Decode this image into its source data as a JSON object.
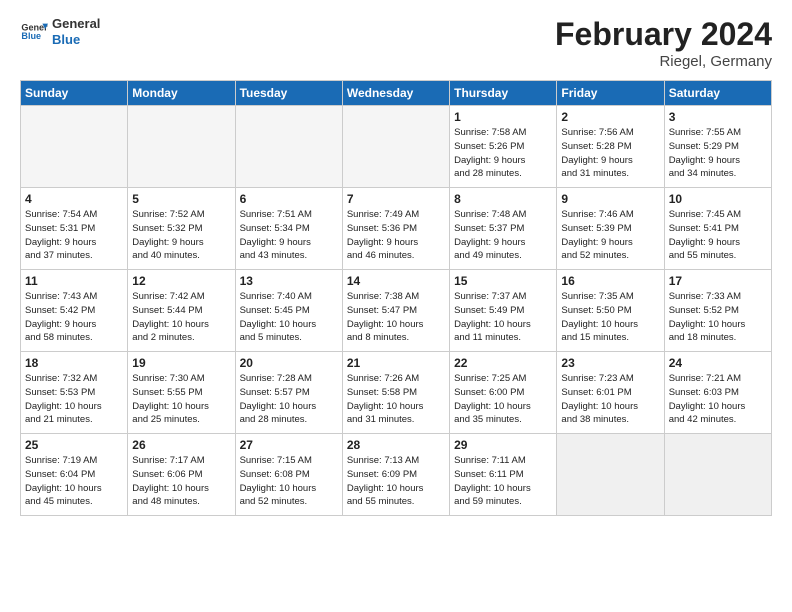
{
  "logo": {
    "general": "General",
    "blue": "Blue"
  },
  "title": "February 2024",
  "subtitle": "Riegel, Germany",
  "days_of_week": [
    "Sunday",
    "Monday",
    "Tuesday",
    "Wednesday",
    "Thursday",
    "Friday",
    "Saturday"
  ],
  "weeks": [
    [
      {
        "num": "",
        "info": "",
        "empty": true
      },
      {
        "num": "",
        "info": "",
        "empty": true
      },
      {
        "num": "",
        "info": "",
        "empty": true
      },
      {
        "num": "",
        "info": "",
        "empty": true
      },
      {
        "num": "1",
        "info": "Sunrise: 7:58 AM\nSunset: 5:26 PM\nDaylight: 9 hours\nand 28 minutes."
      },
      {
        "num": "2",
        "info": "Sunrise: 7:56 AM\nSunset: 5:28 PM\nDaylight: 9 hours\nand 31 minutes."
      },
      {
        "num": "3",
        "info": "Sunrise: 7:55 AM\nSunset: 5:29 PM\nDaylight: 9 hours\nand 34 minutes."
      }
    ],
    [
      {
        "num": "4",
        "info": "Sunrise: 7:54 AM\nSunset: 5:31 PM\nDaylight: 9 hours\nand 37 minutes."
      },
      {
        "num": "5",
        "info": "Sunrise: 7:52 AM\nSunset: 5:32 PM\nDaylight: 9 hours\nand 40 minutes."
      },
      {
        "num": "6",
        "info": "Sunrise: 7:51 AM\nSunset: 5:34 PM\nDaylight: 9 hours\nand 43 minutes."
      },
      {
        "num": "7",
        "info": "Sunrise: 7:49 AM\nSunset: 5:36 PM\nDaylight: 9 hours\nand 46 minutes."
      },
      {
        "num": "8",
        "info": "Sunrise: 7:48 AM\nSunset: 5:37 PM\nDaylight: 9 hours\nand 49 minutes."
      },
      {
        "num": "9",
        "info": "Sunrise: 7:46 AM\nSunset: 5:39 PM\nDaylight: 9 hours\nand 52 minutes."
      },
      {
        "num": "10",
        "info": "Sunrise: 7:45 AM\nSunset: 5:41 PM\nDaylight: 9 hours\nand 55 minutes."
      }
    ],
    [
      {
        "num": "11",
        "info": "Sunrise: 7:43 AM\nSunset: 5:42 PM\nDaylight: 9 hours\nand 58 minutes."
      },
      {
        "num": "12",
        "info": "Sunrise: 7:42 AM\nSunset: 5:44 PM\nDaylight: 10 hours\nand 2 minutes."
      },
      {
        "num": "13",
        "info": "Sunrise: 7:40 AM\nSunset: 5:45 PM\nDaylight: 10 hours\nand 5 minutes."
      },
      {
        "num": "14",
        "info": "Sunrise: 7:38 AM\nSunset: 5:47 PM\nDaylight: 10 hours\nand 8 minutes."
      },
      {
        "num": "15",
        "info": "Sunrise: 7:37 AM\nSunset: 5:49 PM\nDaylight: 10 hours\nand 11 minutes."
      },
      {
        "num": "16",
        "info": "Sunrise: 7:35 AM\nSunset: 5:50 PM\nDaylight: 10 hours\nand 15 minutes."
      },
      {
        "num": "17",
        "info": "Sunrise: 7:33 AM\nSunset: 5:52 PM\nDaylight: 10 hours\nand 18 minutes."
      }
    ],
    [
      {
        "num": "18",
        "info": "Sunrise: 7:32 AM\nSunset: 5:53 PM\nDaylight: 10 hours\nand 21 minutes."
      },
      {
        "num": "19",
        "info": "Sunrise: 7:30 AM\nSunset: 5:55 PM\nDaylight: 10 hours\nand 25 minutes."
      },
      {
        "num": "20",
        "info": "Sunrise: 7:28 AM\nSunset: 5:57 PM\nDaylight: 10 hours\nand 28 minutes."
      },
      {
        "num": "21",
        "info": "Sunrise: 7:26 AM\nSunset: 5:58 PM\nDaylight: 10 hours\nand 31 minutes."
      },
      {
        "num": "22",
        "info": "Sunrise: 7:25 AM\nSunset: 6:00 PM\nDaylight: 10 hours\nand 35 minutes."
      },
      {
        "num": "23",
        "info": "Sunrise: 7:23 AM\nSunset: 6:01 PM\nDaylight: 10 hours\nand 38 minutes."
      },
      {
        "num": "24",
        "info": "Sunrise: 7:21 AM\nSunset: 6:03 PM\nDaylight: 10 hours\nand 42 minutes."
      }
    ],
    [
      {
        "num": "25",
        "info": "Sunrise: 7:19 AM\nSunset: 6:04 PM\nDaylight: 10 hours\nand 45 minutes."
      },
      {
        "num": "26",
        "info": "Sunrise: 7:17 AM\nSunset: 6:06 PM\nDaylight: 10 hours\nand 48 minutes."
      },
      {
        "num": "27",
        "info": "Sunrise: 7:15 AM\nSunset: 6:08 PM\nDaylight: 10 hours\nand 52 minutes."
      },
      {
        "num": "28",
        "info": "Sunrise: 7:13 AM\nSunset: 6:09 PM\nDaylight: 10 hours\nand 55 minutes."
      },
      {
        "num": "29",
        "info": "Sunrise: 7:11 AM\nSunset: 6:11 PM\nDaylight: 10 hours\nand 59 minutes."
      },
      {
        "num": "",
        "info": "",
        "empty": true
      },
      {
        "num": "",
        "info": "",
        "empty": true
      }
    ]
  ]
}
